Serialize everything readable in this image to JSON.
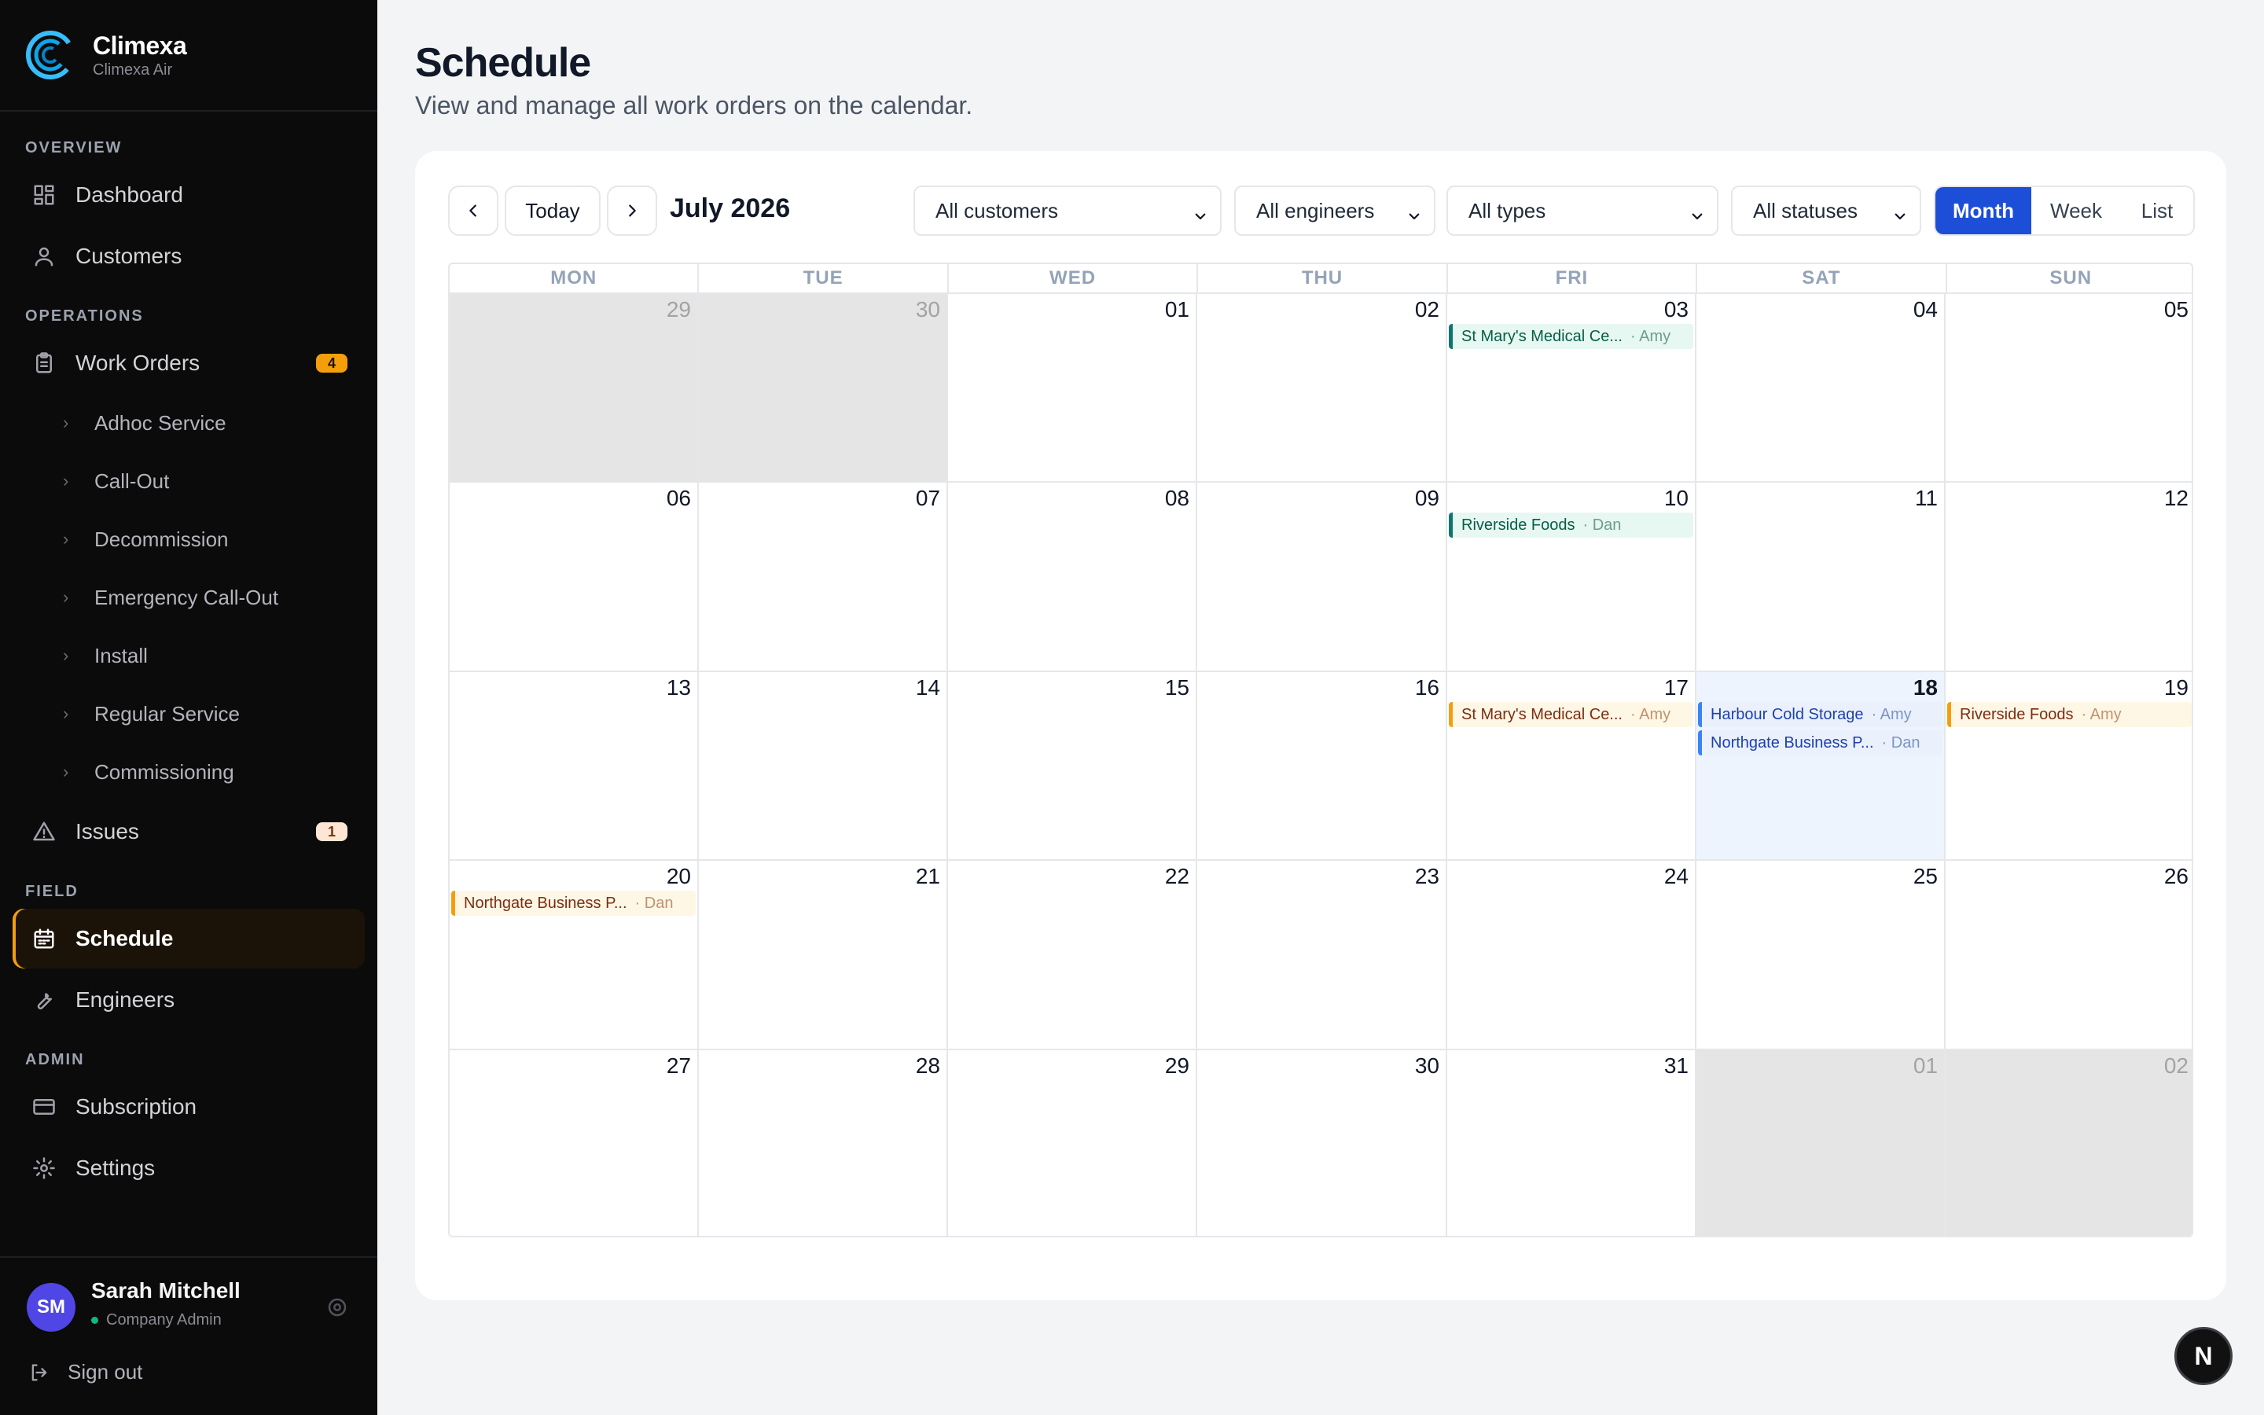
{
  "brand": {
    "name": "Climexa",
    "sub": "Climexa Air"
  },
  "sidebar": {
    "sections": {
      "overview": "OVERVIEW",
      "operations": "OPERATIONS",
      "field": "FIELD",
      "admin": "ADMIN"
    },
    "dashboard": "Dashboard",
    "customers": "Customers",
    "work_orders": {
      "label": "Work Orders",
      "badge": "4"
    },
    "sub_items": [
      "Adhoc Service",
      "Call-Out",
      "Decommission",
      "Emergency Call-Out",
      "Install",
      "Regular Service",
      "Commissioning"
    ],
    "issues": {
      "label": "Issues",
      "badge": "1"
    },
    "schedule": "Schedule",
    "engineers": "Engineers",
    "subscription": "Subscription",
    "settings": "Settings"
  },
  "user": {
    "initials": "SM",
    "name": "Sarah Mitchell",
    "role": "Company Admin",
    "signout": "Sign out"
  },
  "page": {
    "title": "Schedule",
    "subtitle": "View and manage all work orders on the calendar."
  },
  "toolbar": {
    "today": "Today",
    "month_label": "July 2026",
    "filters": {
      "customers": "All customers",
      "engineers": "All engineers",
      "types": "All types",
      "statuses": "All statuses"
    },
    "views": {
      "month": "Month",
      "week": "Week",
      "list": "List"
    },
    "active_view": "Month"
  },
  "calendar": {
    "weekdays": [
      "MON",
      "TUE",
      "WED",
      "THU",
      "FRI",
      "SAT",
      "SUN"
    ],
    "weeks": [
      [
        "29",
        "30",
        "01",
        "02",
        "03",
        "04",
        "05"
      ],
      [
        "06",
        "07",
        "08",
        "09",
        "10",
        "11",
        "12"
      ],
      [
        "13",
        "14",
        "15",
        "16",
        "17",
        "18",
        "19"
      ],
      [
        "20",
        "21",
        "22",
        "23",
        "24",
        "25",
        "26"
      ],
      [
        "27",
        "28",
        "29",
        "30",
        "31",
        "01",
        "02"
      ]
    ],
    "outside_cells": [
      "0-0",
      "0-1",
      "4-5",
      "4-6"
    ],
    "today_cell": "2-5",
    "events": [
      {
        "cell": "0-4",
        "title": "St Mary's Medical Ce...",
        "who": "· Amy",
        "color": "green"
      },
      {
        "cell": "1-4",
        "title": "Riverside Foods",
        "who": "· Dan",
        "color": "green"
      },
      {
        "cell": "2-4",
        "title": "St Mary's Medical Ce...",
        "who": "· Amy",
        "color": "orange"
      },
      {
        "cell": "2-5",
        "title": "Harbour Cold Storage",
        "who": "· Amy",
        "color": "blue"
      },
      {
        "cell": "2-5",
        "title": "Northgate Business P...",
        "who": "· Dan",
        "color": "blue"
      },
      {
        "cell": "2-6",
        "title": "Riverside Foods",
        "who": "· Amy",
        "color": "orange"
      },
      {
        "cell": "3-0",
        "title": "Northgate Business P...",
        "who": "· Dan",
        "color": "orange"
      }
    ]
  },
  "fab": {
    "label": "N"
  },
  "colors": {
    "accent": "#1d4ed8",
    "active_nav": "#f59e0b",
    "sidebar_bg": "#0b0b0c"
  }
}
